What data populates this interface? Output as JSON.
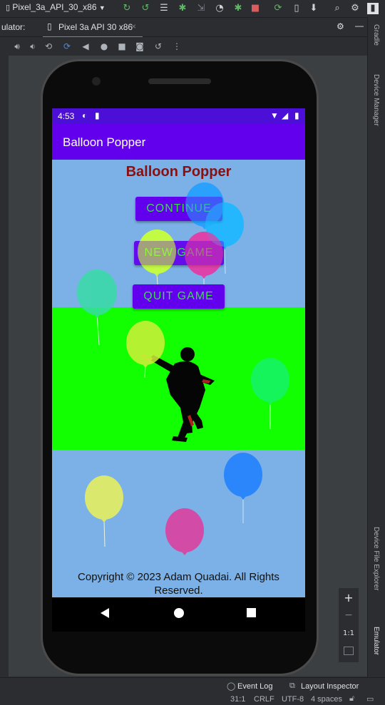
{
  "ide": {
    "device_selector": "Pixel_3a_API_30_x86",
    "panel_label": "ulator:",
    "tab_label": "Pixel 3a API 30 x86",
    "right_labels": {
      "gradle": "Gradle",
      "device_manager": "Device Manager",
      "device_file_explorer": "Device File Explorer",
      "emulator": "Emulator"
    },
    "zoom": {
      "plus": "+",
      "minus": "−",
      "one_to_one": "1:1"
    },
    "bottom": {
      "event_log": "Event Log",
      "layout_inspector": "Layout Inspector",
      "position": "31:1",
      "line_sep": "CRLF",
      "encoding": "UTF-8",
      "indent": "4 spaces"
    }
  },
  "phone": {
    "status_time": "4:53",
    "app_title": "Balloon Popper",
    "game_title": "Balloon Popper",
    "buttons": {
      "continue": "CONTINUE",
      "new_game": "NEW GAME",
      "quit_game": "QUIT GAME"
    },
    "copyright_line1": "Copyright © 2023 Adam Quadai. All Rights",
    "copyright_line2": "Reserved."
  },
  "colors": {
    "status_bar": "#4b0fd8",
    "app_bar": "#6200ee",
    "screen_bg": "#7bb1e6",
    "green_band": "#11ff00",
    "game_title": "#8b0f0f",
    "button_text": "#3cdc4a"
  }
}
